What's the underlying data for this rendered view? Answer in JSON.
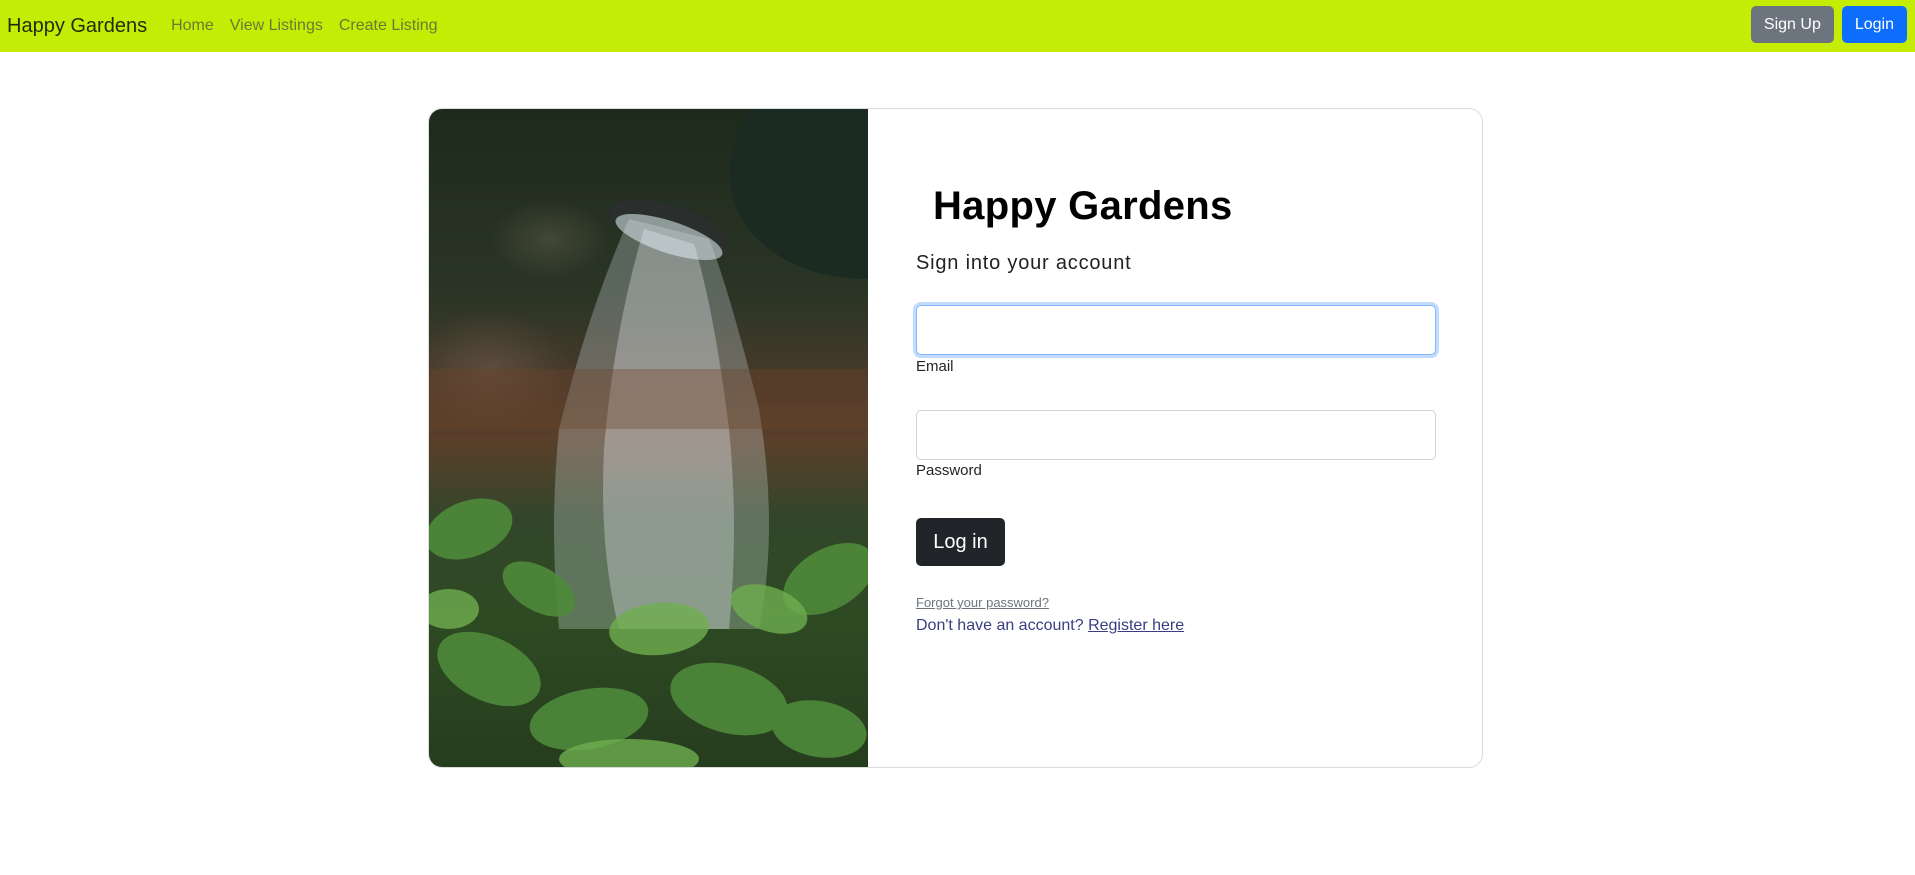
{
  "navbar": {
    "brand": "Happy Gardens",
    "links": [
      "Home",
      "View Listings",
      "Create Listing"
    ],
    "signup_label": "Sign Up",
    "login_label": "Login"
  },
  "login_card": {
    "image_description": "watering-can-spraying-plants",
    "title": "Happy Gardens",
    "subtitle": "Sign into your account",
    "email": {
      "label": "Email",
      "value": ""
    },
    "password": {
      "label": "Password",
      "value": ""
    },
    "submit_label": "Log in",
    "forgot_label": "Forgot your password?",
    "register_prompt": "Don't have an account?",
    "register_link": "Register here"
  },
  "colors": {
    "navbar_bg": "#c5ec05",
    "primary": "#0d6efd",
    "secondary": "#6c757d",
    "dark": "#212529",
    "register_link": "#393f81"
  }
}
